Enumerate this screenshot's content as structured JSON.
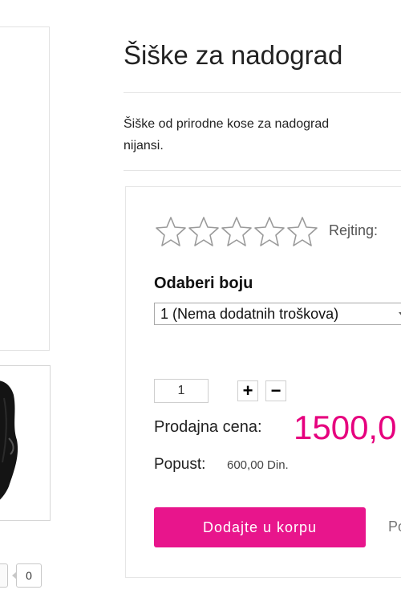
{
  "product": {
    "title": "Šiške za nadograd",
    "description_line1": "Šiške od prirodne kose za nadograd",
    "description_line2": "nijansi."
  },
  "rating": {
    "label": "Rejting:",
    "stars_filled": 0,
    "stars_total": 5
  },
  "color_option": {
    "label": "Odaberi boju",
    "selected": "1 (Nema dodatnih troškova)"
  },
  "quantity": {
    "value": "1",
    "plus_label": "+",
    "minus_label": "−"
  },
  "price": {
    "label": "Prodajna cena:",
    "value": "1500,0"
  },
  "discount": {
    "label": "Popust:",
    "value": "600,00 Din."
  },
  "buttons": {
    "add_to_cart": "Dodajte u korpu",
    "side_link": "Po"
  },
  "share": {
    "count": "0"
  },
  "colors": {
    "accent": "#e8158c",
    "price": "#e6007e",
    "border": "#e4e4e4"
  }
}
